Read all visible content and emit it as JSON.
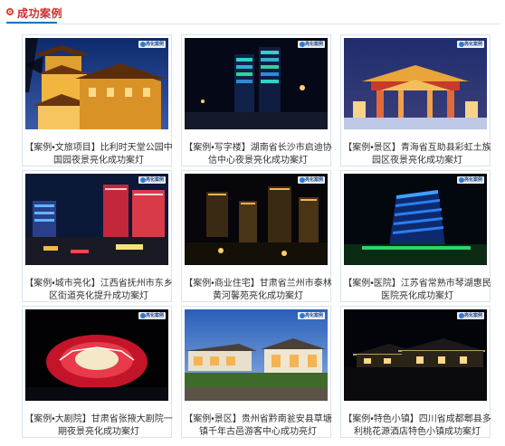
{
  "section": {
    "title": "成功案例",
    "icon": "target-dot-icon",
    "accent": "#c9302c",
    "underline_color": "#1e73be"
  },
  "logo_text": "亮化案例",
  "watermark": "www.ledld.cn",
  "cases": [
    {
      "caption": "【案例•文旅项目】比利时天堂公园中国园夜景亮化成功案灯"
    },
    {
      "caption": "【案例•写字楼】湖南省长沙市启迪协信中心夜景亮化成功案灯"
    },
    {
      "caption": "【案例•景区】青海省互助县彩虹土族园区夜景亮化成功案灯"
    },
    {
      "caption": "【案例•城市亮化】江西省抚州市东乡区街道亮化提升成功案灯"
    },
    {
      "caption": "【案例•商业住宅】甘肃省兰州市泰林黄河馨苑亮化成功案灯"
    },
    {
      "caption": "【案例•医院】江苏省常熟市琴湖惠民医院亮化成功案灯"
    },
    {
      "caption": "【案例•大剧院】甘肃省张掖大剧院一期夜景亮化成功案灯"
    },
    {
      "caption": "【案例•景区】贵州省黔南瓮安县草塘镇千年古邑游客中心成功亮灯"
    },
    {
      "caption": "【案例•特色小镇】四川省成都郫县多利桃花源酒店特色小镇成功案灯"
    }
  ]
}
